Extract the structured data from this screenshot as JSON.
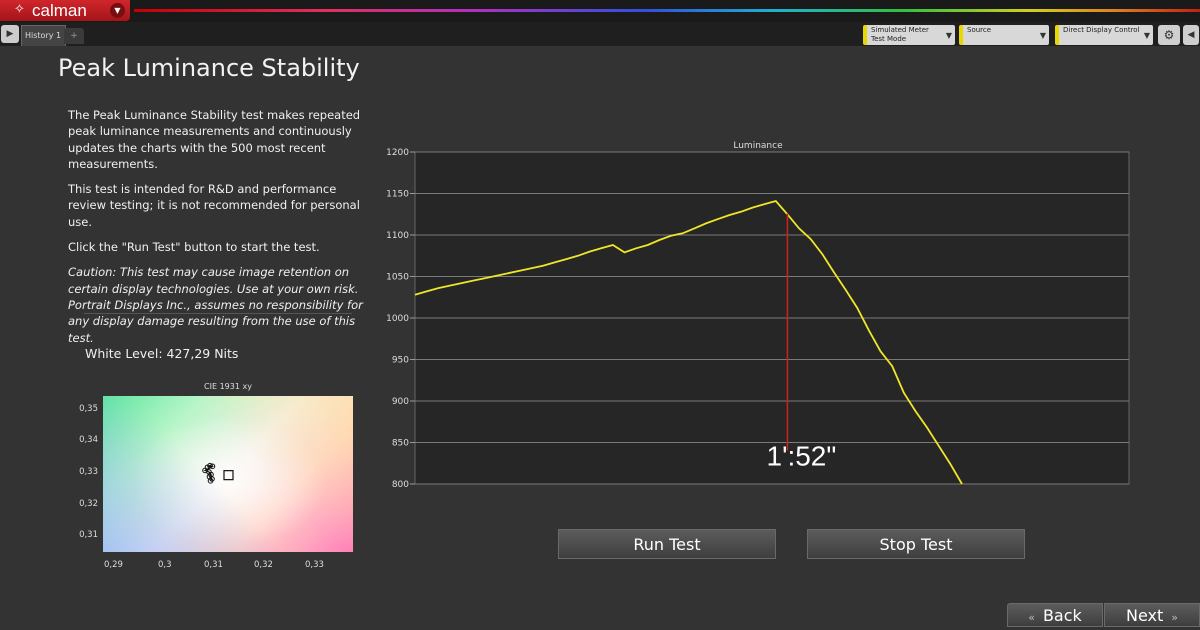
{
  "app": {
    "logo_text": "calman",
    "colors": {
      "brand_red": "#c41e24",
      "background": "#333333",
      "trace": "#f0e628",
      "marker": "#d02020"
    }
  },
  "toolbar": {
    "tab_label": "History 1",
    "add_tab": "+",
    "dropdowns": [
      {
        "label": "Simulated Meter",
        "sub": "Test Mode"
      },
      {
        "label": "Source",
        "sub": ""
      },
      {
        "label": "Direct Display Control",
        "sub": ""
      }
    ]
  },
  "page": {
    "title": "Peak Luminance Stability",
    "description": [
      "The Peak Luminance Stability test makes repeated peak luminance measurements and continuously updates the charts with the 500 most recent measurements.",
      "This test is intended for R&D and performance review testing; it is not recommended for personal use.",
      "Click the \"Run Test\" button to start the test."
    ],
    "caution": "Caution: This test may cause image retention on certain display technologies. Use at your own risk. Portrait Displays Inc., assumes no responsibility for any display damage resulting from the use of this test.",
    "white_level": "White Level: 427,29 Nits"
  },
  "cie": {
    "title": "CIE 1931 xy",
    "x_ticks": [
      "0,29",
      "0,3",
      "0,31",
      "0,32",
      "0,33"
    ],
    "y_ticks": [
      "0,35",
      "0,34",
      "0,33",
      "0,32",
      "0,31"
    ],
    "target_point": {
      "x": 0.3127,
      "y": 0.329
    },
    "measured_points": [
      {
        "x": 0.3085,
        "y": 0.3315
      },
      {
        "x": 0.309,
        "y": 0.332
      },
      {
        "x": 0.3095,
        "y": 0.3318
      },
      {
        "x": 0.308,
        "y": 0.3305
      },
      {
        "x": 0.3088,
        "y": 0.33
      },
      {
        "x": 0.3092,
        "y": 0.3292
      },
      {
        "x": 0.3089,
        "y": 0.3285
      },
      {
        "x": 0.3094,
        "y": 0.3278
      },
      {
        "x": 0.3091,
        "y": 0.3272
      }
    ]
  },
  "chart_data": {
    "type": "line",
    "title": "Luminance",
    "xlabel": "",
    "ylabel": "",
    "ylim": [
      800,
      1200
    ],
    "y_ticks": [
      1200,
      1150,
      1100,
      1050,
      1000,
      950,
      900,
      850,
      800
    ],
    "grid": true,
    "series": [
      {
        "values": [
          1028,
          1032,
          1036,
          1039,
          1042,
          1045,
          1048,
          1051,
          1054,
          1057,
          1060,
          1063,
          1067,
          1071,
          1075,
          1080,
          1084,
          1088,
          1079,
          1084,
          1088,
          1094,
          1099,
          1102,
          1108,
          1114,
          1119,
          1124,
          1128,
          1133,
          1137,
          1141,
          1125,
          1108,
          1095,
          1077,
          1055,
          1034,
          1012,
          985,
          960,
          942,
          910,
          888,
          868,
          846,
          824,
          800
        ]
      }
    ],
    "marker_index": 32,
    "annotation": "1':52\""
  },
  "buttons": {
    "run": "Run Test",
    "stop": "Stop Test",
    "back": "Back",
    "next": "Next"
  }
}
